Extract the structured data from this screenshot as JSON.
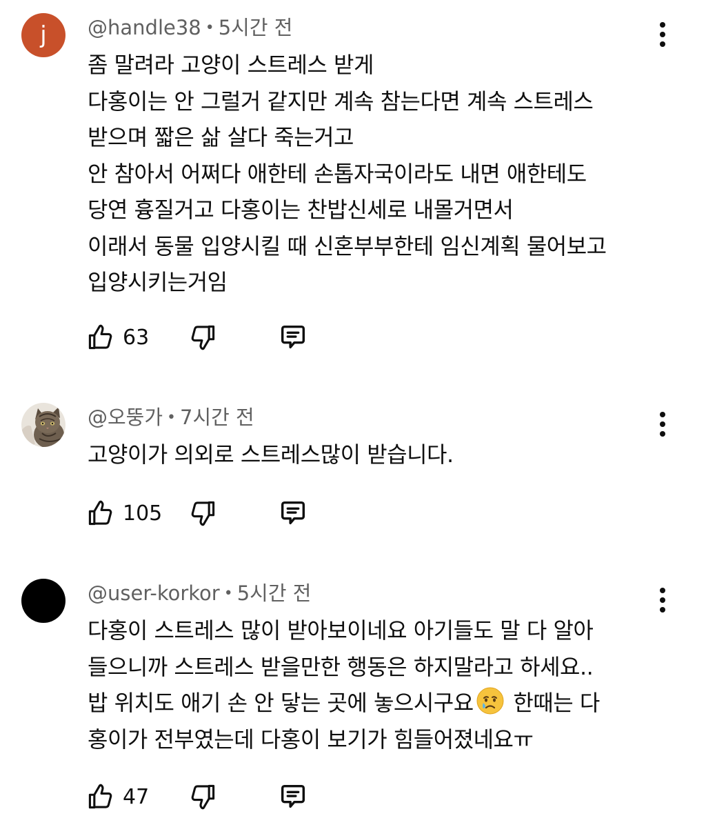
{
  "comments": [
    {
      "avatar": {
        "type": "letter",
        "letter": "j",
        "color": "#c8502a"
      },
      "handle": "@handle38",
      "time": "5시간 전",
      "lines": [
        "좀 말려라 고양이 스트레스 받게",
        "다홍이는 안 그럴거 같지만 계속 참는다면 계속 스트레스",
        "받으며 짧은 삶 살다 죽는거고",
        "안 참아서 어쩌다 애한테 손톱자국이라도 내면 애한테도",
        "당연 흉질거고 다홍이는 찬밥신세로 내몰거면서",
        "이래서 동물 입양시킬 때 신혼부부한테 임신계획 물어보고",
        "입양시키는거임"
      ],
      "likes": "63"
    },
    {
      "avatar": {
        "type": "photo",
        "subject": "tabby-cat"
      },
      "handle": "@오뚱가",
      "time": "7시간 전",
      "lines": [
        "고양이가 의외로 스트레스많이 받습니다."
      ],
      "likes": "105"
    },
    {
      "avatar": {
        "type": "solid",
        "color": "#000000"
      },
      "handle": "@user-korkor",
      "time": "5시간 전",
      "lines": [
        "다홍이 스트레스 많이 받아보이네요 아기들도 말 다 알아",
        "들으니까 스트레스 받을만한 행동은 하지말라고 하세요..",
        "밥 위치도 애기 손 안 닿는 곳에 놓으시구요",
        "홍이가 전부였는데 다홍이 보기가 힘들어졌네요ㅠ"
      ],
      "line3_after_emoji": "한때는 다",
      "emoji": "crying-face",
      "likes": "47"
    }
  ]
}
